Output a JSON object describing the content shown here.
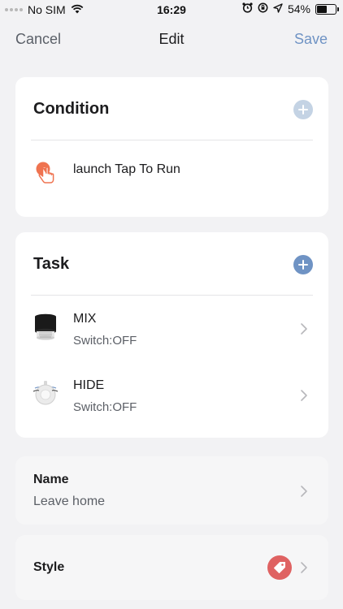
{
  "status_bar": {
    "carrier": "No SIM",
    "time": "16:29",
    "battery": "54%",
    "battery_level": 0.54,
    "icons": [
      "signal-dots-icon",
      "wifi-icon",
      "alarm-icon",
      "lock-rotation-icon",
      "location-arrow-icon",
      "battery-icon"
    ]
  },
  "nav": {
    "cancel_label": "Cancel",
    "title": "Edit",
    "save_label": "Save"
  },
  "condition": {
    "title": "Condition",
    "add_icon": "plus-icon",
    "item": {
      "label": "launch Tap To Run",
      "icon": "tap-hand-icon",
      "icon_color": "#ef7350"
    }
  },
  "task": {
    "title": "Task",
    "add_icon": "plus-icon",
    "items": [
      {
        "name": "MIX",
        "status": "Switch:OFF",
        "icon": "speaker-device-icon"
      },
      {
        "name": "HIDE",
        "status": "Switch:OFF",
        "icon": "knob-switch-icon"
      }
    ]
  },
  "name_section": {
    "label": "Name",
    "value": "Leave home"
  },
  "style_section": {
    "label": "Style",
    "icon": "tag-icon",
    "icon_color": "#df6262"
  },
  "colors": {
    "accent": "#6f93c4",
    "add_disabled": "#c4d3e4",
    "add_enabled": "#6f93c4",
    "background": "#f2f2f4"
  }
}
